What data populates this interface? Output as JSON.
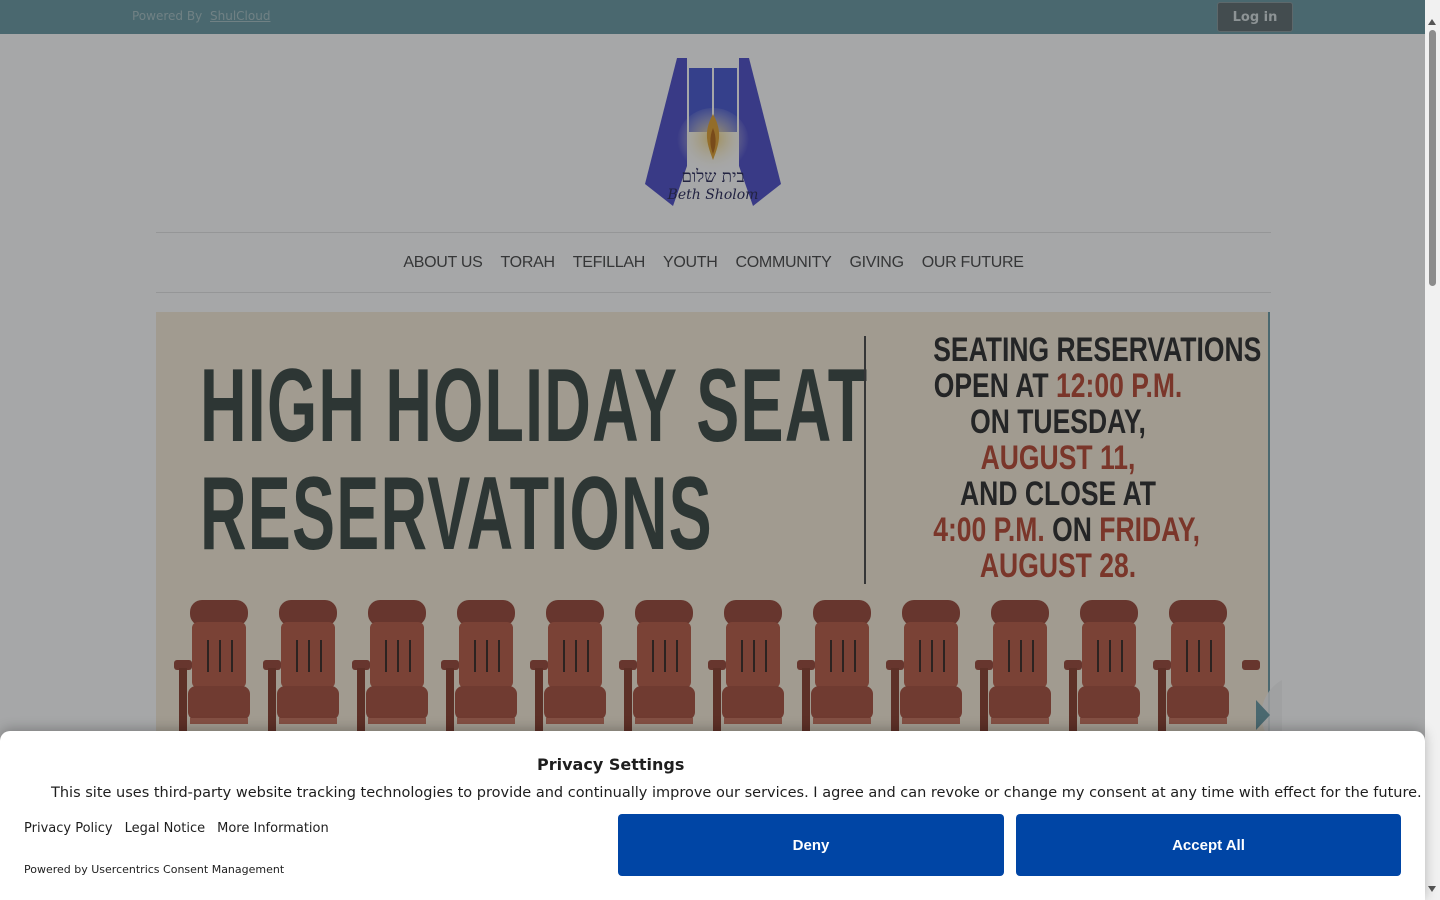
{
  "topbar": {
    "powered_prefix": "Powered By",
    "powered_link": "ShulCloud",
    "login_label": "Log in"
  },
  "logo": {
    "hebrew_text": "בית שלום",
    "english_text": "Beth Sholom"
  },
  "nav": {
    "items": [
      {
        "label": "ABOUT US"
      },
      {
        "label": "TORAH"
      },
      {
        "label": "TEFILLAH"
      },
      {
        "label": "YOUTH"
      },
      {
        "label": "COMMUNITY"
      },
      {
        "label": "GIVING"
      },
      {
        "label": "OUR FUTURE"
      }
    ]
  },
  "banner": {
    "headline_line1": "HIGH HOLIDAY SEAT",
    "headline_line2": "RESERVATIONS",
    "info": {
      "line1": "SEATING RESERVATIONS",
      "line2_a": "OPEN AT ",
      "line2_b": "12:00 P.M.",
      "line3": "ON TUESDAY,",
      "line4": "AUGUST 11,",
      "line5": "AND CLOSE AT",
      "line6_a": "4:00 P.M.",
      "line6_b": " ON ",
      "line6_c": "FRIDAY,",
      "line7": "AUGUST 28."
    },
    "seat_count": 12
  },
  "consent": {
    "title": "Privacy Settings",
    "text": "This site uses third-party website tracking technologies to provide and continually improve our services. I agree and can revoke or change my consent at any time with effect for the future.",
    "links": [
      "Privacy Policy",
      "Legal Notice",
      "More Information"
    ],
    "powered": "Powered by Usercentrics Consent Management",
    "deny_label": "Deny",
    "accept_label": "Accept All"
  },
  "colors": {
    "topbar": "#6b9aa3",
    "button_blue": "#0045a5",
    "headline": "#3d4a44",
    "accent_red": "#b84a35",
    "seat": "#b85c47"
  }
}
